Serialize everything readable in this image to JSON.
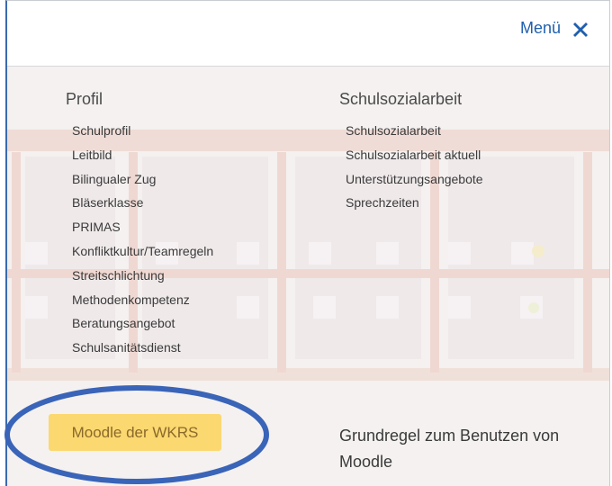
{
  "header": {
    "menu_label": "Menü",
    "close_icon": "close-icon",
    "accent_color": "#1f5fae"
  },
  "profil": {
    "title": "Profil",
    "items": [
      "Schulprofil",
      "Leitbild",
      "Bilingualer Zug",
      "Bläserklasse",
      "PRIMAS",
      "Konfliktkultur/Teamregeln",
      "Streitschlichtung",
      "Methodenkompetenz",
      "Beratungsangebot",
      "Schulsanitätsdienst"
    ]
  },
  "schulsozialarbeit": {
    "title": "Schulsozialarbeit",
    "items": [
      "Schulsozialarbeit",
      "Schulsozialarbeit aktuell",
      "Unterstützungsangebote",
      "Sprechzeiten"
    ]
  },
  "moodle": {
    "button_label": "Moodle der WKRS",
    "button_color": "#fbd870",
    "rule_link": "Grundregel zum Benutzen von Moodle"
  },
  "annotation": {
    "oval_color": "#3a64b8"
  }
}
